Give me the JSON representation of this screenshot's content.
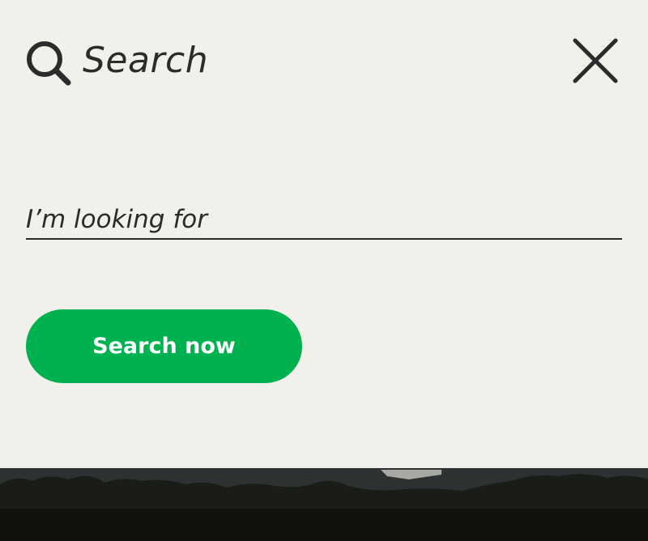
{
  "header": {
    "title": "Search",
    "search_icon": "search-icon",
    "close_icon": "close-icon"
  },
  "form": {
    "input_placeholder": "I’m looking for",
    "input_value": "",
    "submit_label": "Search now"
  },
  "colors": {
    "background": "#f2f0eb",
    "text": "#2b2b2b",
    "accent": "#00b14f",
    "button_text": "#ffffff"
  }
}
